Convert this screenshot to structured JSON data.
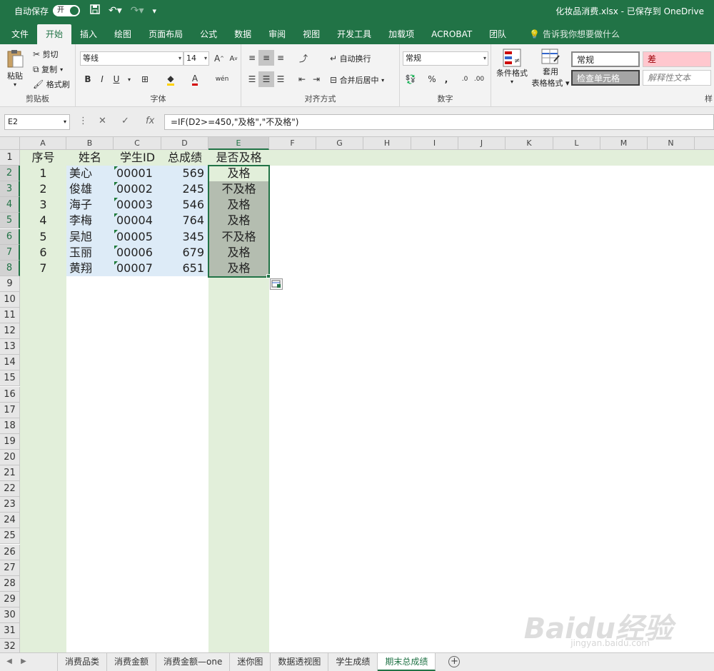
{
  "title_bar": {
    "autosave_label": "自动保存",
    "autosave_toggle": "开",
    "save_icon": "floppy-icon",
    "undo_icon": "undo-icon",
    "redo_icon": "redo-icon",
    "customize_icon": "customize-icon",
    "doc_title": "化妆品消费.xlsx - 已保存到 OneDrive"
  },
  "ribbon_tabs": [
    "文件",
    "开始",
    "插入",
    "绘图",
    "页面布局",
    "公式",
    "数据",
    "审阅",
    "视图",
    "开发工具",
    "加载项",
    "ACROBAT",
    "团队"
  ],
  "active_tab": "开始",
  "tell_me": "告诉我你想要做什么",
  "clipboard": {
    "paste": "粘贴",
    "cut": "剪切",
    "copy": "复制",
    "format_painter": "格式刷",
    "label": "剪贴板"
  },
  "font": {
    "name": "等线",
    "size": "14",
    "bold": "B",
    "italic": "I",
    "underline": "U",
    "grow": "A",
    "shrink": "A",
    "phonetic": "wén",
    "label": "字体"
  },
  "alignment": {
    "wrap_text": "自动换行",
    "merge_center": "合并后居中",
    "label": "对齐方式"
  },
  "number": {
    "format": "常规",
    "percent": "%",
    "comma": ",",
    "label": "数字"
  },
  "styles": {
    "conditional": "条件格式",
    "table_format_line1": "套用",
    "table_format_line2": "表格格式",
    "normal": "常规",
    "bad": "差",
    "check_cell": "检查单元格",
    "explanatory": "解释性文本",
    "label": "样"
  },
  "formula_bar": {
    "name_box": "E2",
    "formula": "=IF(D2>=450,\"及格\",\"不及格\")"
  },
  "columns": [
    "A",
    "B",
    "C",
    "D",
    "E",
    "F",
    "G",
    "H",
    "I",
    "J",
    "K",
    "L",
    "M",
    "N"
  ],
  "selected_column": "E",
  "row_numbers": [
    "1",
    "2",
    "3",
    "4",
    "5",
    "6",
    "7",
    "8",
    "9",
    "10",
    "11",
    "12",
    "13",
    "14",
    "15",
    "16",
    "17",
    "18",
    "19",
    "20",
    "21",
    "22",
    "23",
    "24",
    "25",
    "26",
    "27",
    "28",
    "29",
    "30",
    "31",
    "32"
  ],
  "table": {
    "headers": [
      "序号",
      "姓名",
      "学生ID",
      "总成绩",
      "是否及格"
    ],
    "rows": [
      [
        "1",
        "美心",
        "00001",
        "569",
        "及格"
      ],
      [
        "2",
        "俊雄",
        "00002",
        "245",
        "不及格"
      ],
      [
        "3",
        "海子",
        "00003",
        "546",
        "及格"
      ],
      [
        "4",
        "李梅",
        "00004",
        "764",
        "及格"
      ],
      [
        "5",
        "吴旭",
        "00005",
        "345",
        "不及格"
      ],
      [
        "6",
        "玉丽",
        "00006",
        "679",
        "及格"
      ],
      [
        "7",
        "黄翔",
        "00007",
        "651",
        "及格"
      ]
    ]
  },
  "sheet_tabs": [
    "消费品类",
    "消费金额",
    "消费金额—one",
    "迷你图",
    "数据透视图",
    "学生成绩",
    "期末总成绩"
  ],
  "active_sheet": "期末总成绩",
  "colors": {
    "brand": "#217346",
    "band_green": "#e2efda",
    "band_blue": "#ddebf7",
    "selected_fill": "#b4bdb0"
  },
  "watermark": {
    "main": "Baidu经验",
    "sub": "jingyan.baidu.com"
  }
}
